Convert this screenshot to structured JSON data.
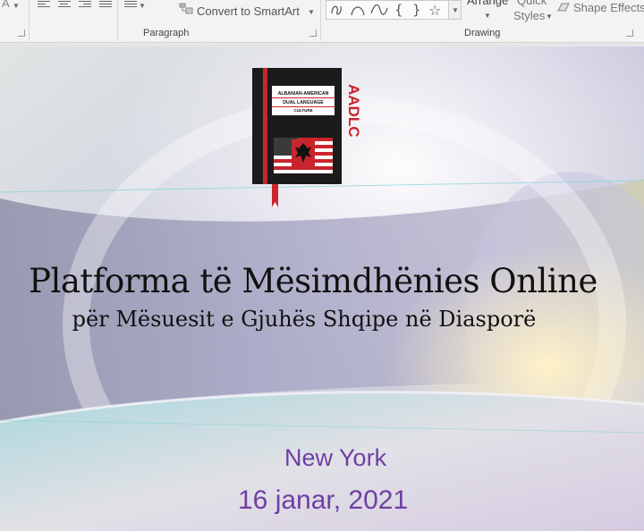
{
  "ribbon": {
    "font_partial": "A",
    "convert_smartart": "Convert to SmartArt",
    "paragraph_label": "Paragraph",
    "drawing_label": "Drawing",
    "arrange": "Arrange",
    "quick": "Quick",
    "styles": "Styles",
    "shape_effects": "Shape Effects"
  },
  "slide": {
    "logo": {
      "line1": "ALBANIAN-AMERICAN",
      "line2": "DUAL LANGUAGE",
      "line3": "CULTURE",
      "acronym": "AADLC"
    },
    "title": "Platforma të Mësimdhënies Online",
    "subtitle": "për Mësuesit e Gjuhës Shqipe në Diasporë",
    "city": "New York",
    "date": "16 janar, 2021",
    "colors": {
      "accent_text": "#6f3fa5",
      "logo_red": "#c9252c",
      "logo_dark": "#1b1b1b"
    }
  }
}
